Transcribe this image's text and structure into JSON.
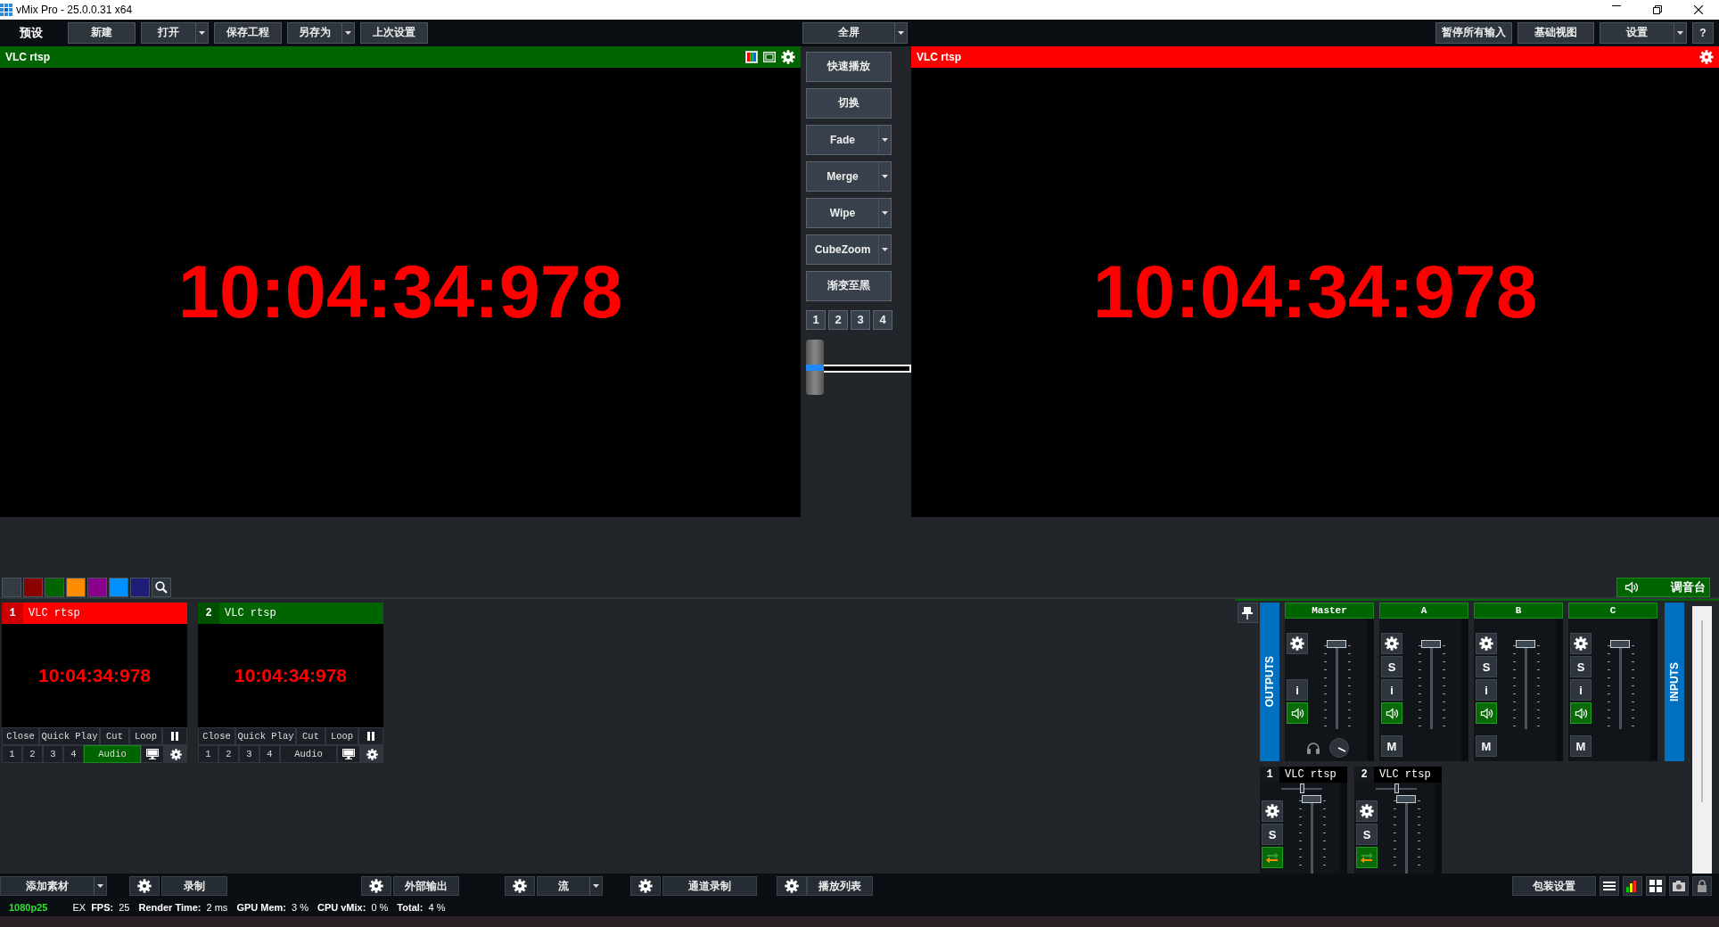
{
  "window": {
    "title": "vMix Pro - 25.0.0.31 x64"
  },
  "toolbar": {
    "left": [
      {
        "label": "预设",
        "kind": "label"
      },
      {
        "label": "新建",
        "kind": "button"
      },
      {
        "label": "打开",
        "kind": "dropdown"
      },
      {
        "label": "保存工程",
        "kind": "button"
      },
      {
        "label": "另存为",
        "kind": "dropdown"
      },
      {
        "label": "上次设置",
        "kind": "button"
      }
    ],
    "center": [
      {
        "label": "全屏",
        "kind": "dropdown"
      }
    ],
    "right": [
      {
        "label": "暂停所有输入",
        "kind": "button"
      },
      {
        "label": "基础视图",
        "kind": "button"
      },
      {
        "label": "设置",
        "kind": "dropdown"
      },
      {
        "label": "?",
        "kind": "button"
      }
    ]
  },
  "preview": {
    "title": "VLC rtsp",
    "color": "#006400",
    "timecode": "10:04:34:978"
  },
  "transitions": {
    "buttons": [
      {
        "label": "快速播放",
        "kind": "button"
      },
      {
        "label": "切换",
        "kind": "button"
      },
      {
        "label": "Fade",
        "kind": "dropdown"
      },
      {
        "label": "Merge",
        "kind": "dropdown"
      },
      {
        "label": "Wipe",
        "kind": "dropdown"
      },
      {
        "label": "CubeZoom",
        "kind": "dropdown"
      },
      {
        "label": "渐变至黑",
        "kind": "button"
      }
    ],
    "overlays": [
      "1",
      "2",
      "3",
      "4"
    ],
    "tbar": {
      "level": 0
    }
  },
  "program": {
    "title": "VLC rtsp",
    "color": "#ff0000",
    "timecode": "10:04:34:978"
  },
  "color_filters": [
    {
      "color": "#353b43"
    },
    {
      "color": "#8b0000"
    },
    {
      "color": "#006400"
    },
    {
      "color": "#ff8c00"
    },
    {
      "color": "#8b008b"
    },
    {
      "color": "#0090ff"
    },
    {
      "color": "#1e1e78"
    }
  ],
  "mixer_toggle": {
    "label": "调音台",
    "on": true
  },
  "inputs": [
    {
      "number": "1",
      "title": "VLC rtsp",
      "color": "#ff0000",
      "timecode": "10:04:34:978",
      "controls": [
        "Close",
        "Quick Play",
        "Cut",
        "Loop"
      ],
      "overlays": [
        "1",
        "2",
        "3",
        "4"
      ],
      "audio": {
        "label": "Audio",
        "on": true
      }
    },
    {
      "number": "2",
      "title": "VLC rtsp",
      "color": "#006400",
      "timecode": "10:04:34:978",
      "controls": [
        "Close",
        "Quick Play",
        "Cut",
        "Loop"
      ],
      "overlays": [
        "1",
        "2",
        "3",
        "4"
      ],
      "audio": {
        "label": "Audio",
        "on": false
      }
    }
  ],
  "audio_mixer": {
    "outputs_label": "OUTPUTS",
    "inputs_label": "INPUTS",
    "buses": [
      {
        "kind": "master",
        "name": "Master",
        "info": "i",
        "speaker_on": true,
        "fader": {
          "level": 1
        }
      },
      {
        "kind": "bus",
        "name": "A",
        "solo": "S",
        "info": "i",
        "mute": "M",
        "speaker_on": true,
        "fader": {
          "level": 1
        }
      },
      {
        "kind": "bus",
        "name": "B",
        "solo": "S",
        "info": "i",
        "mute": "M",
        "speaker_on": true,
        "fader": {
          "level": 1
        }
      },
      {
        "kind": "bus",
        "name": "C",
        "solo": "S",
        "info": "i",
        "mute": "M",
        "speaker_on": true,
        "fader": {
          "level": 1
        }
      }
    ],
    "channels": [
      {
        "number": "1",
        "name": "VLC rtsp",
        "solo": "S",
        "pan": {
          "level": 0.5
        },
        "fader": {
          "level": 1
        }
      },
      {
        "number": "2",
        "name": "VLC rtsp",
        "solo": "S",
        "pan": {
          "level": 0.5
        },
        "fader": {
          "level": 1
        }
      }
    ]
  },
  "bottom_bar": {
    "left": [
      {
        "kind": "dropdown",
        "label": "添加素材"
      },
      {
        "kind": "settings"
      },
      {
        "kind": "button",
        "label": "录制"
      },
      {
        "kind": "settings"
      },
      {
        "kind": "button",
        "label": "外部输出"
      },
      {
        "kind": "settings"
      },
      {
        "kind": "dropdown",
        "label": "流"
      },
      {
        "kind": "settings"
      },
      {
        "kind": "button",
        "label": "通道录制"
      },
      {
        "kind": "settings"
      },
      {
        "kind": "button",
        "label": "播放列表"
      }
    ],
    "right": [
      {
        "kind": "button",
        "label": "包装设置"
      }
    ]
  },
  "status_bar": {
    "format": "1080p25",
    "mode": "EX",
    "stats": [
      {
        "label": "FPS:",
        "value": "25"
      },
      {
        "label": "Render Time:",
        "value": "2 ms"
      },
      {
        "label": "GPU Mem:",
        "value": "3 %"
      },
      {
        "label": "CPU vMix:",
        "value": "0 %"
      },
      {
        "label": "Total:",
        "value": "4 %"
      }
    ]
  }
}
